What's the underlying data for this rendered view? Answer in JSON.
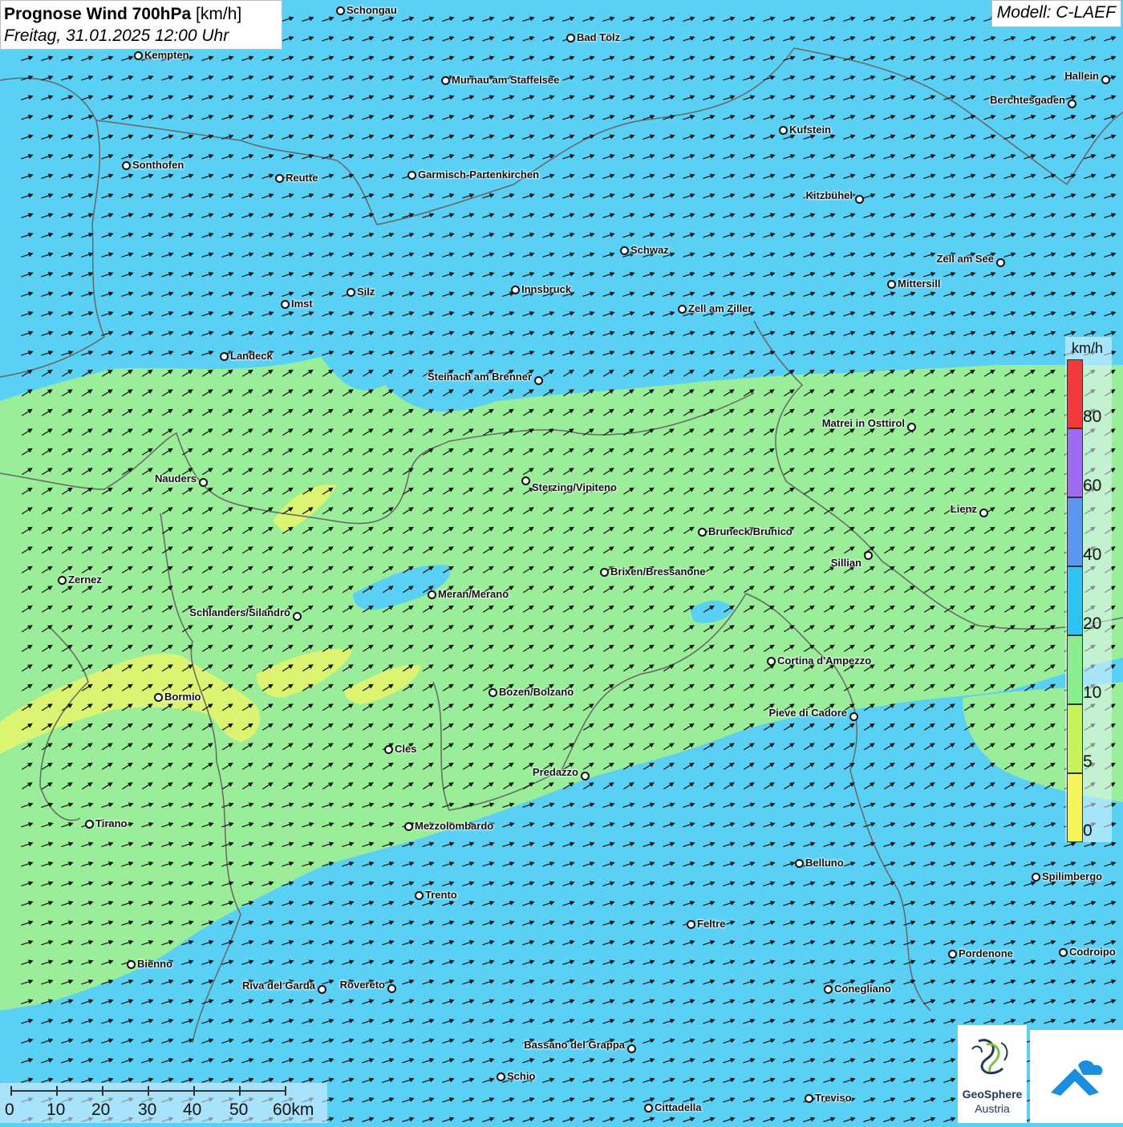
{
  "header": {
    "title_bold": "Prognose Wind 700hPa",
    "title_unit": "[km/h]",
    "subtitle": "Freitag, 31.01.2025 12:00 Uhr",
    "model": "Modell: C-LAEF"
  },
  "cities": [
    "Schongau",
    "Bad Tölz",
    "Kempten",
    "Murnau am Staffelsee",
    "Hallein",
    "Berchtesgaden",
    "Kufstein",
    "Sonthofen",
    "Reutte",
    "Garmisch-Partenkirchen",
    "Kitzbühel",
    "Schwaz",
    "Zell am See",
    "Mittersill",
    "Innsbruck",
    "Silz",
    "Imst",
    "Zell am Ziller",
    "Landeck",
    "Steinach am Brenner",
    "Matrei in Osttirol",
    "Nauders",
    "Sterzing/Vipiteno",
    "Lienz",
    "Bruneck/Brunico",
    "Sillian",
    "Brixen/Bressanone",
    "Zernez",
    "Meran/Merano",
    "Schlanders/Silandro",
    "Cortina d'Ampezzo",
    "Bozen/Bolzano",
    "Bormio",
    "Pieve di Cadore",
    "Cles",
    "Predazzo",
    "Tirano",
    "Mezzolombardo",
    "Belluno",
    "Spilimbergo",
    "Trento",
    "Feltre",
    "Pordenone",
    "Codroipo",
    "Bienno",
    "Riva del Garda",
    "Rovereto",
    "Conegliano",
    "Bassano del Grappa",
    "Schio",
    "Treviso",
    "Cittadella"
  ],
  "legend": {
    "unit": "km/h",
    "ticks": [
      "80",
      "60",
      "40",
      "20",
      "10",
      "5",
      "0"
    ],
    "colors": [
      "#f23a3a",
      "#9d6cf0",
      "#5b97ee",
      "#2ec4f2",
      "#88ee8e",
      "#c6f25a",
      "#f6f55a"
    ]
  },
  "scalebar": {
    "labels": [
      "0",
      "10",
      "20",
      "30",
      "40",
      "50",
      "60km"
    ]
  },
  "logos": {
    "geosphere_line1": "GeoSphere",
    "geosphere_line2": "Austria"
  },
  "colors": {
    "wind_low_blue": "#5bd0f5",
    "wind_green": "#9aee9a",
    "wind_yellow": "#e8f56a",
    "arrow": "#111111",
    "border_line": "#666666"
  }
}
